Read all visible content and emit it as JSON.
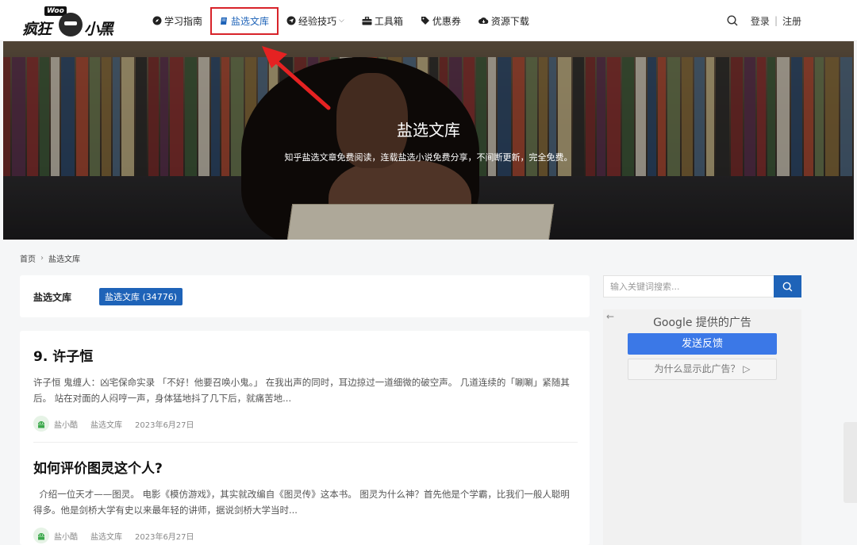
{
  "header": {
    "logo": {
      "badge": "Woo",
      "text_left": "疯狂",
      "text_right": "小黑"
    },
    "nav": [
      {
        "label": "学习指南",
        "icon": "compass-icon"
      },
      {
        "label": "盐选文库",
        "icon": "book-icon",
        "active": true
      },
      {
        "label": "经验技巧",
        "icon": "send-icon",
        "dropdown": true
      },
      {
        "label": "工具箱",
        "icon": "toolbox-icon"
      },
      {
        "label": "优惠券",
        "icon": "tag-icon"
      },
      {
        "label": "资源下载",
        "icon": "cloud-download-icon"
      }
    ],
    "login": "登录",
    "separator": "|",
    "register": "注册"
  },
  "banner": {
    "title": "盐选文库",
    "subtitle": "知乎盐选文章免费阅读，连载盐选小说免费分享，不间断更新，完全免费。"
  },
  "breadcrumb": {
    "home": "首页",
    "current": "盐选文库"
  },
  "category": {
    "label": "盐选文库",
    "tag": "盐选文库 (34776)"
  },
  "posts": [
    {
      "title": "9. 许子恒",
      "excerpt": "许子恒 鬼缠人：凶宅保命实录 「不好！他要召唤小鬼。」 在我出声的同时，耳边掠过一道细微的破空声。 几道连续的「唰唰」紧随其后。 站在对面的人闷哼一声，身体猛地抖了几下后，就痛苦地...",
      "author": "盐小酷",
      "category": "盐选文库",
      "date": "2023年6月27日"
    },
    {
      "title": "如何评价图灵这个人?",
      "excerpt": "  介绍一位天才——图灵。 电影《模仿游戏》，其实就改编自《图灵传》这本书。 图灵为什么神？首先他是个学霸，比我们一般人聪明得多。他是剑桥大学有史以来最年轻的讲师，据说剑桥大学当时...",
      "author": "盐小酷",
      "category": "盐选文库",
      "date": "2023年6月27日"
    }
  ],
  "sidebar": {
    "search_placeholder": "输入关键词搜索...",
    "ad": {
      "back": "←",
      "provided": "Google 提供的广告",
      "feedback": "发送反馈",
      "why": "为什么显示此广告？ ▷"
    }
  },
  "colors": {
    "accent": "#1e63b8",
    "highlight_box": "#d8232a",
    "ad_button": "#3b78e7"
  }
}
